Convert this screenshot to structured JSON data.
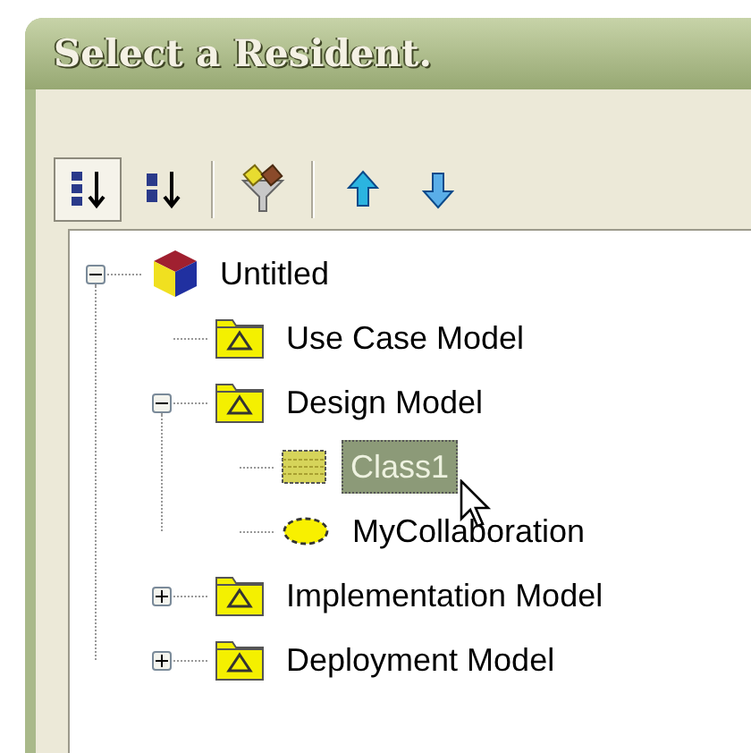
{
  "window": {
    "title": "Select a Resident."
  },
  "toolbar": {
    "groups": [
      [
        {
          "kind": "sort-numeric",
          "selected": true
        },
        {
          "kind": "sort-alpha",
          "selected": false
        }
      ],
      [
        {
          "kind": "filter",
          "selected": false
        }
      ],
      [
        {
          "kind": "move-up",
          "selected": false
        },
        {
          "kind": "move-down",
          "selected": false
        }
      ]
    ]
  },
  "tree": [
    {
      "label": "Untitled",
      "kind": "project",
      "expanded": true,
      "selected": false,
      "children": [
        {
          "label": "Use Case Model",
          "kind": "package",
          "selected": false
        },
        {
          "label": "Design Model",
          "kind": "package",
          "expanded": true,
          "selected": false,
          "children": [
            {
              "label": "Class1",
              "kind": "class",
              "selected": true
            },
            {
              "label": "MyCollaboration",
              "kind": "collaboration",
              "selected": false
            }
          ]
        },
        {
          "label": "Implementation Model",
          "kind": "package",
          "expanded": false,
          "selected": false
        },
        {
          "label": "Deployment Model",
          "kind": "package",
          "expanded": false,
          "selected": false
        }
      ]
    }
  ]
}
